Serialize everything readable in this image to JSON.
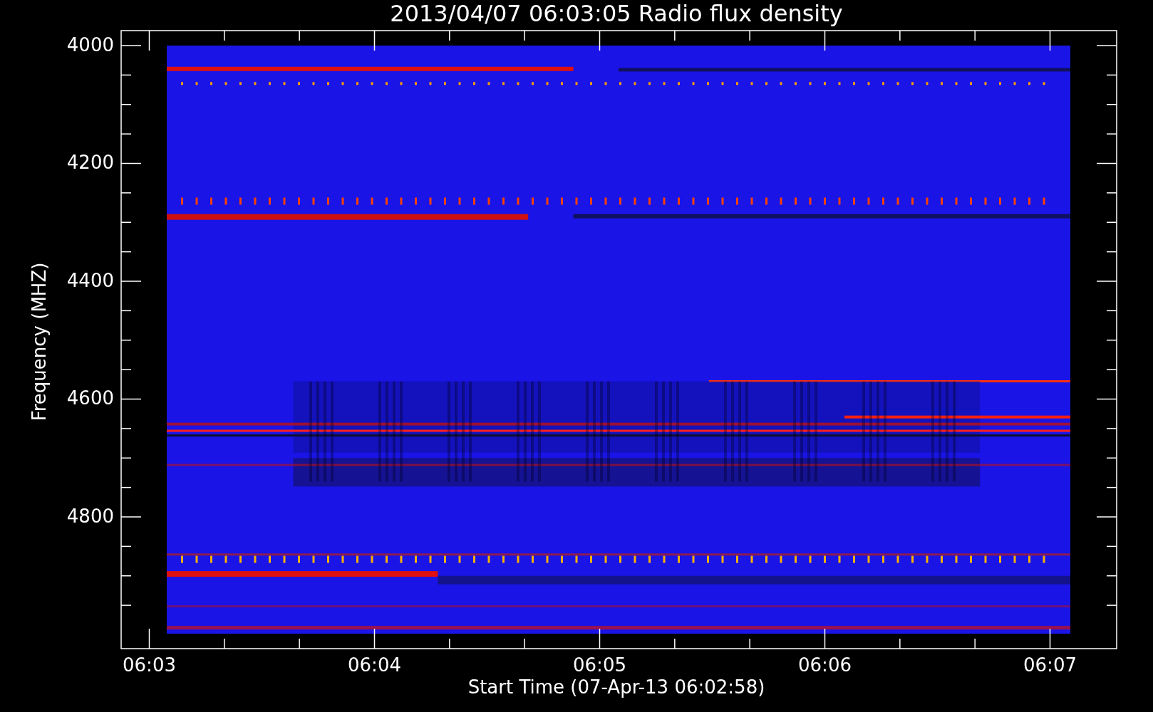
{
  "title": "2013/04/07 06:03:05 Radio flux density",
  "y_axis": {
    "label": "Frequency (MHZ)",
    "ticks": [
      "4000",
      "4200",
      "4400",
      "4600",
      "4800"
    ]
  },
  "x_axis": {
    "label": "Start Time (07-Apr-13 06:02:58)",
    "ticks": [
      "06:03",
      "06:04",
      "06:05",
      "06:06",
      "06:07"
    ]
  }
}
